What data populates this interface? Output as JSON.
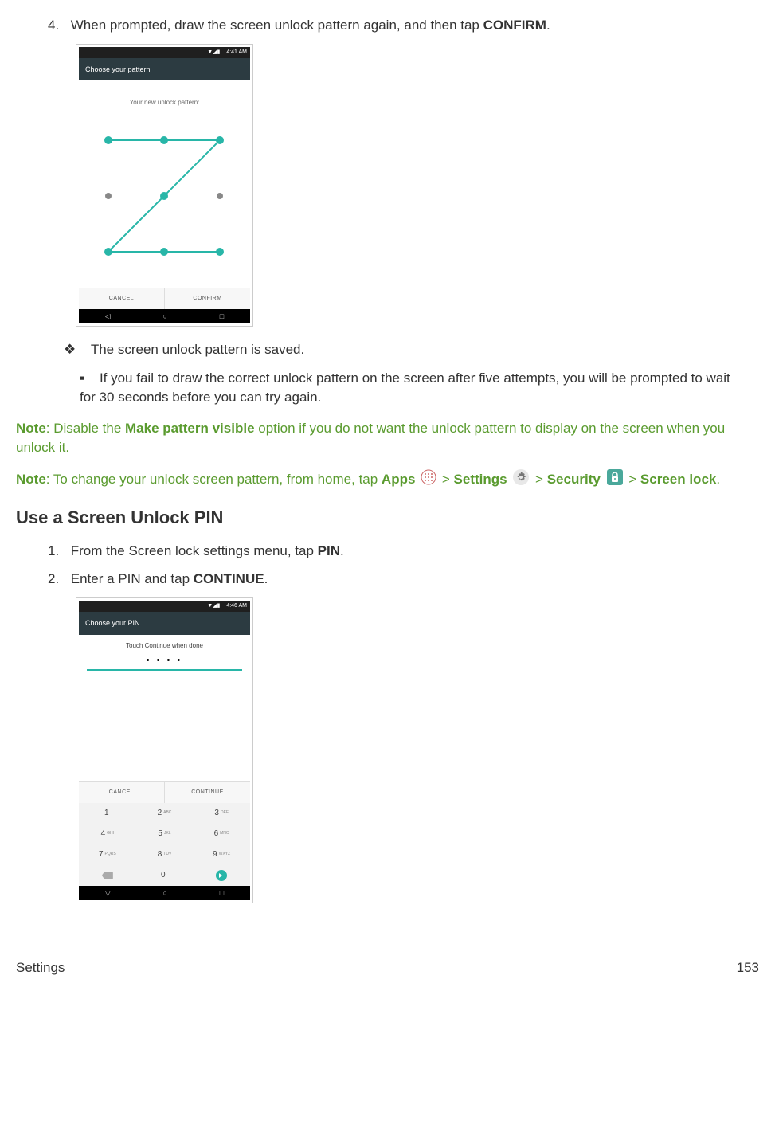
{
  "step4": {
    "num": "4.",
    "text_a": "When prompted, draw the screen unlock pattern again, and then tap ",
    "confirm": "CONFIRM",
    "text_b": "."
  },
  "phone1": {
    "time": "4:41 AM",
    "status_icons": "▼◢▮",
    "title": "Choose your pattern",
    "subtitle": "Your new unlock pattern:",
    "btn_left": "CANCEL",
    "btn_right": "CONFIRM"
  },
  "bullet1": {
    "marker": "❖",
    "text": "The screen unlock pattern is saved."
  },
  "bullet2": {
    "marker": "▪",
    "text": "If you fail to draw the correct unlock pattern on the screen after five attempts, you will be prompted to wait for 30 seconds before you can try again."
  },
  "note1": {
    "label": "Note",
    "text_a": ": Disable the ",
    "bold": "Make pattern visible",
    "text_b": " option if you do not want the unlock pattern to display on the screen when you unlock it."
  },
  "note2": {
    "label": "Note",
    "text_a": ": To change your unlock screen pattern, from home, tap ",
    "apps": "Apps",
    "gt1": " > ",
    "settings": "Settings",
    "gt2": " > ",
    "security": "Security",
    "gt3": " > ",
    "screenlock": "Screen lock",
    "text_b": "."
  },
  "heading": "Use a Screen Unlock PIN",
  "pin_step1": {
    "num": "1.",
    "text_a": "From the Screen lock settings menu, tap ",
    "pin": "PIN",
    "text_b": "."
  },
  "pin_step2": {
    "num": "2.",
    "text_a": "Enter a PIN and tap ",
    "cont": "CONTINUE",
    "text_b": "."
  },
  "phone2": {
    "time": "4:46 AM",
    "status_icons": "▼◢▮",
    "title": "Choose your PIN",
    "subtitle": "Touch Continue when done",
    "pin_display": "• • • •",
    "btn_left": "CANCEL",
    "btn_right": "CONTINUE",
    "keys": {
      "r1": [
        "1",
        "2",
        "3"
      ],
      "r1sub": [
        "",
        "ABC",
        "DEF"
      ],
      "r2": [
        "4",
        "5",
        "6"
      ],
      "r2sub": [
        "GHI",
        "JKL",
        "MNO"
      ],
      "r3": [
        "7",
        "8",
        "9"
      ],
      "r3sub": [
        "PQRS",
        "TUV",
        "WXYZ"
      ],
      "r4": [
        "",
        "0",
        ""
      ],
      "r4sub": [
        "",
        ".",
        ""
      ]
    }
  },
  "footer": {
    "left": "Settings",
    "right": "153"
  }
}
